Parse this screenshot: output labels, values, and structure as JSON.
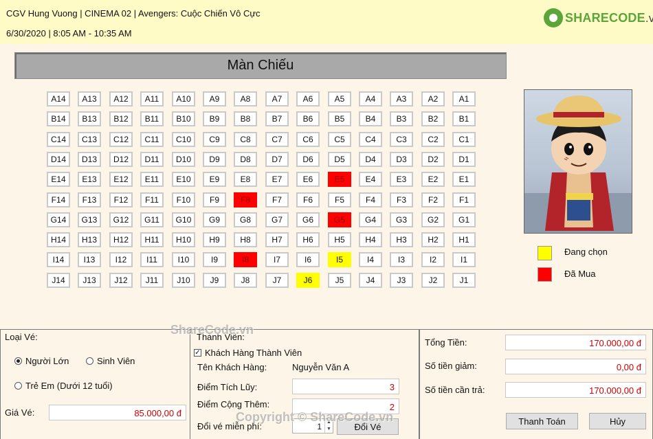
{
  "header": {
    "line1": "CGV Hung Vuong | CINEMA 02 | Avengers: Cuộc Chiến Vô Cực",
    "line2": "6/30/2020 | 8:05 AM - 10:35 AM",
    "logo_main": "SHARECODE",
    "logo_suffix": ".vn"
  },
  "screen_label": "Màn Chiếu",
  "seat_rows": [
    "A",
    "B",
    "C",
    "D",
    "E",
    "F",
    "G",
    "H",
    "I",
    "J"
  ],
  "seat_cols": [
    14,
    13,
    12,
    11,
    10,
    9,
    8,
    7,
    6,
    5,
    4,
    3,
    2,
    1
  ],
  "seats_sold": [
    "E5",
    "F8",
    "G5",
    "I8"
  ],
  "seats_selected": [
    "I5",
    "J6"
  ],
  "legend": {
    "selecting_label": "Đang chọn",
    "selecting_color": "#ffff00",
    "purchased_label": "Đã Mua",
    "purchased_color": "#ff0000"
  },
  "ticket": {
    "type_label": "Loại Vé:",
    "options": [
      "Người Lớn",
      "Sinh Viên",
      "Trẻ Em (Dưới 12 tuổi)"
    ],
    "selected": "Người Lớn",
    "price_label": "Giá Vé:",
    "price_value": "85.000,00 đ"
  },
  "member": {
    "section_label": "Thành Viên:",
    "checkbox_label": "Khách Hàng Thành Viên",
    "checked": true,
    "name_label": "Tên Khách Hàng:",
    "name_value": "Nguyễn Văn A",
    "points_label": "Điểm Tích Lũy:",
    "points_value": "3",
    "bonus_label": "Điểm Cộng Thêm:",
    "bonus_value": "2",
    "free_label": "Đổi vé miễn phí:",
    "free_value": "1",
    "redeem_button": "Đổi Vé"
  },
  "totals": {
    "total_label": "Tổng Tiền:",
    "total_value": "170.000,00 đ",
    "discount_label": "Số tiền giảm:",
    "discount_value": "0,00 đ",
    "pay_label": "Số tiền cần trả:",
    "pay_value": "170.000,00 đ",
    "pay_button": "Thanh Toán",
    "cancel_button": "Hủy"
  },
  "watermarks": {
    "mid": "ShareCode.vn",
    "bottom": "Copyright © ShareCode.vn"
  }
}
